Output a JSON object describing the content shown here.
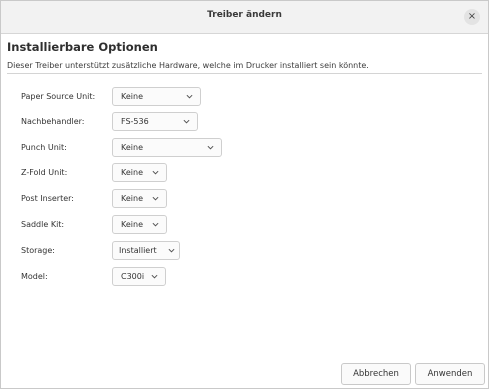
{
  "window": {
    "title": "Treiber ändern",
    "close_label": "×"
  },
  "header": {
    "heading": "Installierbare Optionen",
    "description": "Dieser Treiber unterstützt zusätzliche Hardware, welche im Drucker installiert sein könnte."
  },
  "options": [
    {
      "label": "Paper Source Unit:",
      "value": "Keine"
    },
    {
      "label": "Nachbehandler:",
      "value": "FS-536"
    },
    {
      "label": "Punch Unit:",
      "value": "Keine"
    },
    {
      "label": "Z-Fold Unit:",
      "value": "Keine"
    },
    {
      "label": "Post Inserter:",
      "value": "Keine"
    },
    {
      "label": "Saddle Kit:",
      "value": "Keine"
    },
    {
      "label": "Storage:",
      "value": "Installiert"
    },
    {
      "label": "Model:",
      "value": "C300i"
    }
  ],
  "footer": {
    "cancel_label": "Abbrechen",
    "apply_label": "Anwenden"
  },
  "icons": {
    "close": "close-icon",
    "dropdown": "chevron-down-icon"
  }
}
